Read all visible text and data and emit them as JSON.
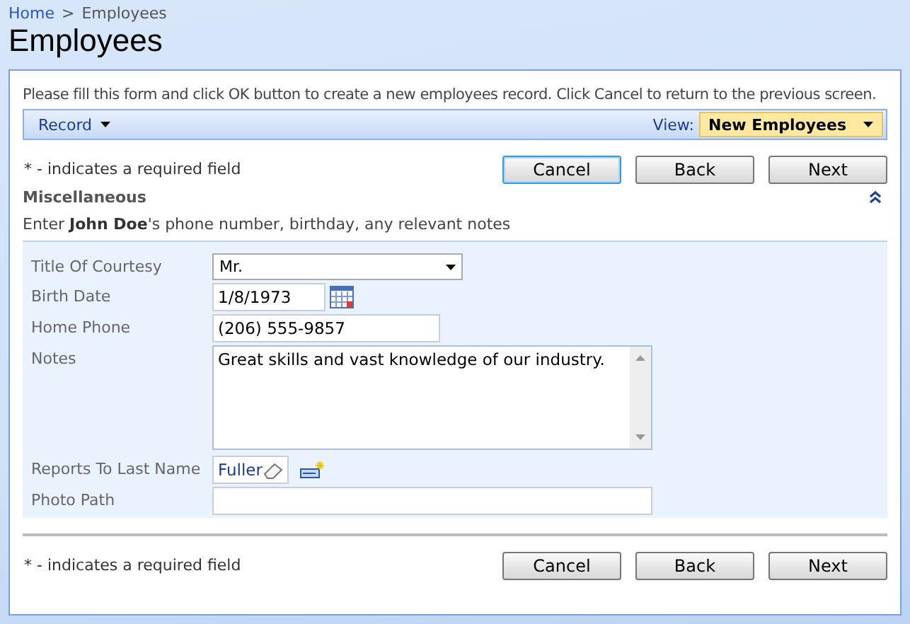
{
  "breadcrumb": {
    "items": [
      "Home",
      "Employees"
    ],
    "separator": ">"
  },
  "page_title": "Employees",
  "instructions": "Please fill this form and click OK button to create a new employees record. Click Cancel to return to the previous screen.",
  "toolbar": {
    "menu": "Record",
    "view_label": "View:",
    "view_value": "New Employees"
  },
  "top_bar": {
    "required_note": "* - indicates a required field",
    "buttons": [
      {
        "label": "Cancel",
        "focused": true
      },
      {
        "label": "Back",
        "focused": false
      },
      {
        "label": "Next",
        "focused": false
      }
    ]
  },
  "section": {
    "title": "Miscellaneous",
    "description": "Enter **John Doe**'s phone number, birthday, any relevant notes",
    "expanded": true
  },
  "fields": [
    {
      "label": "Title Of Courtesy",
      "kind": "select",
      "value": "Mr."
    },
    {
      "label": "Birth Date",
      "kind": "date",
      "value": "1/8/1973"
    },
    {
      "label": "Home Phone",
      "kind": "text",
      "value": "(206) 555-9857"
    },
    {
      "label": "Notes",
      "kind": "textarea",
      "value": "Great skills and vast knowledge of our industry."
    },
    {
      "label": "Reports To Last Name",
      "kind": "lookup",
      "value": "Fuller"
    },
    {
      "label": "Photo Path",
      "kind": "text"
    }
  ],
  "bottom_bar": {
    "required_note": "* - indicates a required field",
    "buttons": [
      {
        "label": "Cancel",
        "focused": false
      },
      {
        "label": "Back",
        "focused": false
      },
      {
        "label": "Next",
        "focused": false
      }
    ]
  }
}
